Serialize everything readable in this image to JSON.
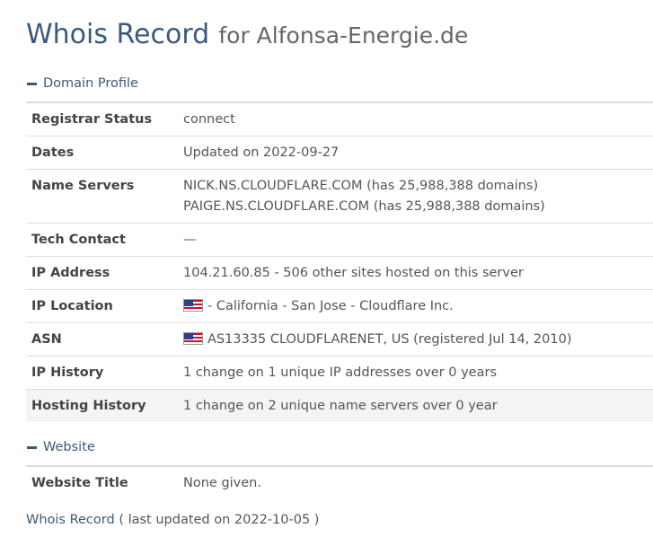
{
  "title": {
    "main": "Whois Record",
    "for": "for Alfonsa-Energie.de"
  },
  "domain_profile": {
    "header": "Domain Profile",
    "rows": [
      {
        "label": "Registrar Status",
        "value": "connect"
      },
      {
        "label": "Dates",
        "value": "Updated on 2022-09-27"
      },
      {
        "label": "Name Servers",
        "value_lines": [
          "NICK.NS.CLOUDFLARE.COM (has 25,988,388 domains)",
          "PAIGE.NS.CLOUDFLARE.COM (has 25,988,388 domains)"
        ]
      },
      {
        "label": "Tech Contact",
        "value": "—"
      },
      {
        "label": "IP Address",
        "value": "104.21.60.85 - 506 other sites hosted on this server"
      },
      {
        "label": "IP Location",
        "value": "- California - San Jose - Cloudflare Inc.",
        "flag": "us-flag-icon"
      },
      {
        "label": "ASN",
        "value": "AS13335 CLOUDFLARENET, US (registered Jul 14, 2010)",
        "flag": "us-flag-icon"
      },
      {
        "label": "IP History",
        "value": "1 change on 1 unique IP addresses over 0 years"
      },
      {
        "label": "Hosting History",
        "value": "1 change on 2 unique name servers over 0 year"
      }
    ]
  },
  "website": {
    "header": "Website",
    "rows": [
      {
        "label": "Website Title",
        "value": "None given."
      }
    ]
  },
  "footer": {
    "title": "Whois Record",
    "subtitle": "( last updated on 2022-10-05 )"
  },
  "colors": {
    "accent": "#3b5a7a",
    "shaded_row": "#f4f4f4"
  }
}
